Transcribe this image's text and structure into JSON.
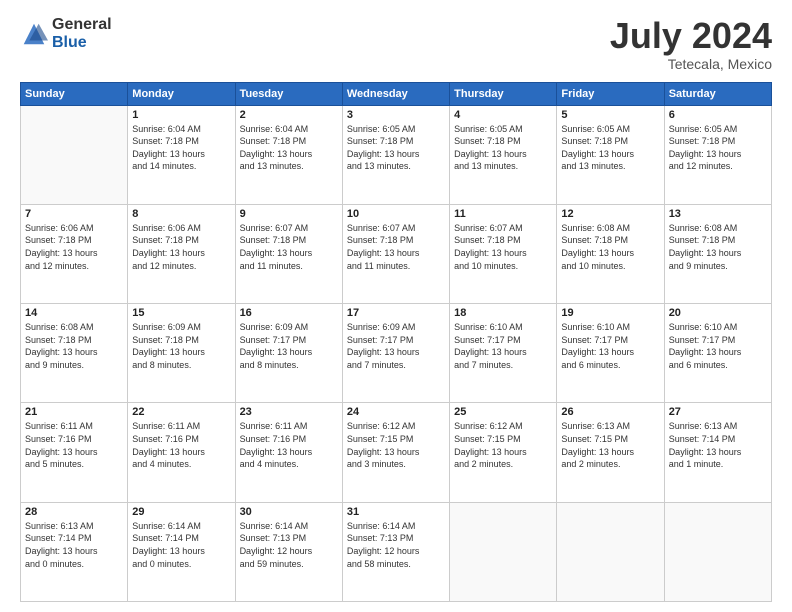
{
  "logo": {
    "general": "General",
    "blue": "Blue"
  },
  "title": {
    "month_year": "July 2024",
    "location": "Tetecala, Mexico"
  },
  "days_of_week": [
    "Sunday",
    "Monday",
    "Tuesday",
    "Wednesday",
    "Thursday",
    "Friday",
    "Saturday"
  ],
  "weeks": [
    [
      {
        "day": "",
        "info": ""
      },
      {
        "day": "1",
        "info": "Sunrise: 6:04 AM\nSunset: 7:18 PM\nDaylight: 13 hours\nand 14 minutes."
      },
      {
        "day": "2",
        "info": "Sunrise: 6:04 AM\nSunset: 7:18 PM\nDaylight: 13 hours\nand 13 minutes."
      },
      {
        "day": "3",
        "info": "Sunrise: 6:05 AM\nSunset: 7:18 PM\nDaylight: 13 hours\nand 13 minutes."
      },
      {
        "day": "4",
        "info": "Sunrise: 6:05 AM\nSunset: 7:18 PM\nDaylight: 13 hours\nand 13 minutes."
      },
      {
        "day": "5",
        "info": "Sunrise: 6:05 AM\nSunset: 7:18 PM\nDaylight: 13 hours\nand 13 minutes."
      },
      {
        "day": "6",
        "info": "Sunrise: 6:05 AM\nSunset: 7:18 PM\nDaylight: 13 hours\nand 12 minutes."
      }
    ],
    [
      {
        "day": "7",
        "info": "Sunrise: 6:06 AM\nSunset: 7:18 PM\nDaylight: 13 hours\nand 12 minutes."
      },
      {
        "day": "8",
        "info": "Sunrise: 6:06 AM\nSunset: 7:18 PM\nDaylight: 13 hours\nand 12 minutes."
      },
      {
        "day": "9",
        "info": "Sunrise: 6:07 AM\nSunset: 7:18 PM\nDaylight: 13 hours\nand 11 minutes."
      },
      {
        "day": "10",
        "info": "Sunrise: 6:07 AM\nSunset: 7:18 PM\nDaylight: 13 hours\nand 11 minutes."
      },
      {
        "day": "11",
        "info": "Sunrise: 6:07 AM\nSunset: 7:18 PM\nDaylight: 13 hours\nand 10 minutes."
      },
      {
        "day": "12",
        "info": "Sunrise: 6:08 AM\nSunset: 7:18 PM\nDaylight: 13 hours\nand 10 minutes."
      },
      {
        "day": "13",
        "info": "Sunrise: 6:08 AM\nSunset: 7:18 PM\nDaylight: 13 hours\nand 9 minutes."
      }
    ],
    [
      {
        "day": "14",
        "info": "Sunrise: 6:08 AM\nSunset: 7:18 PM\nDaylight: 13 hours\nand 9 minutes."
      },
      {
        "day": "15",
        "info": "Sunrise: 6:09 AM\nSunset: 7:18 PM\nDaylight: 13 hours\nand 8 minutes."
      },
      {
        "day": "16",
        "info": "Sunrise: 6:09 AM\nSunset: 7:17 PM\nDaylight: 13 hours\nand 8 minutes."
      },
      {
        "day": "17",
        "info": "Sunrise: 6:09 AM\nSunset: 7:17 PM\nDaylight: 13 hours\nand 7 minutes."
      },
      {
        "day": "18",
        "info": "Sunrise: 6:10 AM\nSunset: 7:17 PM\nDaylight: 13 hours\nand 7 minutes."
      },
      {
        "day": "19",
        "info": "Sunrise: 6:10 AM\nSunset: 7:17 PM\nDaylight: 13 hours\nand 6 minutes."
      },
      {
        "day": "20",
        "info": "Sunrise: 6:10 AM\nSunset: 7:17 PM\nDaylight: 13 hours\nand 6 minutes."
      }
    ],
    [
      {
        "day": "21",
        "info": "Sunrise: 6:11 AM\nSunset: 7:16 PM\nDaylight: 13 hours\nand 5 minutes."
      },
      {
        "day": "22",
        "info": "Sunrise: 6:11 AM\nSunset: 7:16 PM\nDaylight: 13 hours\nand 4 minutes."
      },
      {
        "day": "23",
        "info": "Sunrise: 6:11 AM\nSunset: 7:16 PM\nDaylight: 13 hours\nand 4 minutes."
      },
      {
        "day": "24",
        "info": "Sunrise: 6:12 AM\nSunset: 7:15 PM\nDaylight: 13 hours\nand 3 minutes."
      },
      {
        "day": "25",
        "info": "Sunrise: 6:12 AM\nSunset: 7:15 PM\nDaylight: 13 hours\nand 2 minutes."
      },
      {
        "day": "26",
        "info": "Sunrise: 6:13 AM\nSunset: 7:15 PM\nDaylight: 13 hours\nand 2 minutes."
      },
      {
        "day": "27",
        "info": "Sunrise: 6:13 AM\nSunset: 7:14 PM\nDaylight: 13 hours\nand 1 minute."
      }
    ],
    [
      {
        "day": "28",
        "info": "Sunrise: 6:13 AM\nSunset: 7:14 PM\nDaylight: 13 hours\nand 0 minutes."
      },
      {
        "day": "29",
        "info": "Sunrise: 6:14 AM\nSunset: 7:14 PM\nDaylight: 13 hours\nand 0 minutes."
      },
      {
        "day": "30",
        "info": "Sunrise: 6:14 AM\nSunset: 7:13 PM\nDaylight: 12 hours\nand 59 minutes."
      },
      {
        "day": "31",
        "info": "Sunrise: 6:14 AM\nSunset: 7:13 PM\nDaylight: 12 hours\nand 58 minutes."
      },
      {
        "day": "",
        "info": ""
      },
      {
        "day": "",
        "info": ""
      },
      {
        "day": "",
        "info": ""
      }
    ]
  ]
}
